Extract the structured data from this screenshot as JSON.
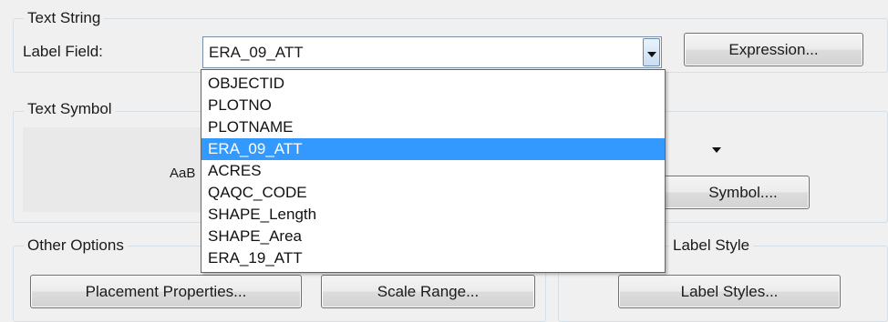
{
  "text_string": {
    "legend": "Text String",
    "label_field_label": "Label Field:",
    "label_field_value": "ERA_09_ATT",
    "expression_button": "Expression...",
    "dropdown_items": [
      "OBJECTID",
      "PLOTNO",
      "PLOTNAME",
      "ERA_09_ATT",
      "ACRES",
      "QAQC_CODE",
      "SHAPE_Length",
      "SHAPE_Area",
      "ERA_19_ATT"
    ],
    "selected_index": 3
  },
  "text_symbol": {
    "legend": "Text Symbol",
    "preview_text": "AaB",
    "symbol_button": "Symbol...."
  },
  "other_options": {
    "legend": "Other Options",
    "placement_button": "Placement Properties...",
    "scale_range_button": "Scale Range..."
  },
  "label_style": {
    "legend": "Label Style",
    "label_styles_button": "Label Styles..."
  },
  "colors": {
    "selection": "#3399ff",
    "group_border": "#d5dfe5",
    "background": "#f0f0f0"
  }
}
